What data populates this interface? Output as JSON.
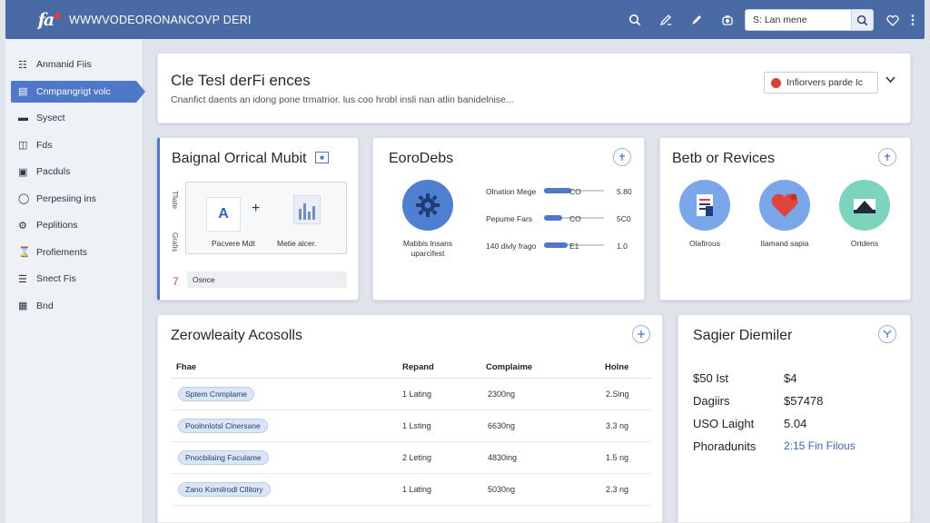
{
  "topbar": {
    "app_title": "WWWVODEORONANCOVP DERI",
    "search_value": "S: Lan mene",
    "icons": [
      "search-icon",
      "edit-icon",
      "pen-icon",
      "camera-icon",
      "heart-icon",
      "more-icon"
    ]
  },
  "sidebar": {
    "items": [
      {
        "label": "Anmanid Fiis",
        "icon": "grid-icon",
        "active": false
      },
      {
        "label": "Cnmpangrigt volc",
        "icon": "document-icon",
        "active": true
      },
      {
        "label": "Sysect",
        "icon": "card-icon",
        "active": false
      },
      {
        "label": "Fds",
        "icon": "tag-icon",
        "active": false
      },
      {
        "label": "Pacduls",
        "icon": "box-icon",
        "active": false
      },
      {
        "label": "Perpesiing ins",
        "icon": "circle-icon",
        "active": false
      },
      {
        "label": "Peplitions",
        "icon": "mic-icon",
        "active": false
      },
      {
        "label": "Profiements",
        "icon": "hourglass-icon",
        "active": false
      },
      {
        "label": "Snect Fis",
        "icon": "list-icon",
        "active": false
      },
      {
        "label": "Bnd",
        "icon": "file-icon",
        "active": false
      }
    ]
  },
  "header": {
    "title": "Cle Tesl derFi ences",
    "subtitle": "Cnanfict daents an idong pone trmatrior. lus coo hrobl insli nan atlin banidelnise...",
    "button_label": "Infiorvers parde Ic",
    "accent": "#d94037"
  },
  "card_integration": {
    "title": "Baignal Orrical Mubit",
    "axis_top": "Tfiate",
    "axis_bottom": "Grafis",
    "tile_a": "A",
    "tile_plus": "+",
    "label_left": "Pacvere Mdt",
    "label_right": "Metie alcer.",
    "count": "7",
    "row_text": "Osnce"
  },
  "card_metrics": {
    "title": "EoroDebs",
    "caption": "Mabbis lnsans uparcifest",
    "rows": [
      {
        "label": "Olnation Mege",
        "value": "CO",
        "right": "5.80",
        "level": 0.45
      },
      {
        "label": "Pepume Fars",
        "value": "CO",
        "right": "5C0",
        "level": 0.3
      },
      {
        "label": "140 divly frago",
        "value": "E1",
        "right": "1.0",
        "level": 0.4
      }
    ]
  },
  "card_services": {
    "title": "Betb or Revices",
    "items": [
      {
        "label": "Olafirous",
        "icon": "document-icon",
        "color": "#7aa6ea"
      },
      {
        "label": "Ilamand sapia",
        "icon": "heart-icon",
        "color": "#7aa6ea"
      },
      {
        "label": "Ortdens",
        "icon": "tray-icon",
        "color": "#7cd4bd"
      }
    ]
  },
  "table_card": {
    "title": "Zerowleaity Acosolls",
    "columns": [
      "Fhae",
      "Repand",
      "Complaime",
      "Holne"
    ],
    "rows": [
      {
        "name": "Sptem Cnmplame",
        "c1": "1 Lating",
        "c2": "2300ng",
        "c3": "2.Sing"
      },
      {
        "name": "Poolnnlotsl Clnersane",
        "c1": "1 Lsting",
        "c2": "6630ng",
        "c3": "3.3 ng"
      },
      {
        "name": "Pnocbilaing Faculame",
        "c1": "2 Leting",
        "c2": "4830ing",
        "c3": "1.5 ng"
      },
      {
        "name": "Zano Komilrodl Cllitory",
        "c1": "1 Lating",
        "c2": "5030ng",
        "c3": "2.3 ng"
      }
    ]
  },
  "summary_card": {
    "title": "Sagier Diemiler",
    "rows": [
      {
        "k": "$50 Ist",
        "v": "$4"
      },
      {
        "k": "Dagiirs",
        "v": "$57478"
      },
      {
        "k": "USO Laight",
        "v": "5.04"
      },
      {
        "k": "Phoradunits",
        "v": "2:15 Fin Filous"
      }
    ]
  }
}
